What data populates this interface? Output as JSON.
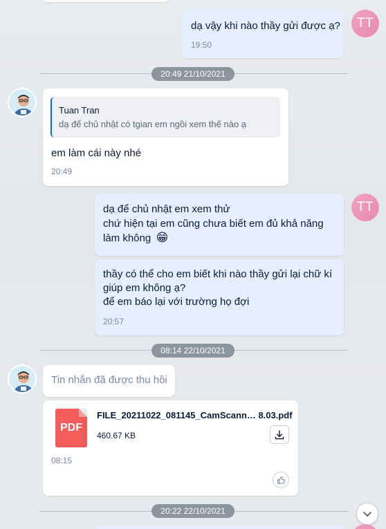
{
  "messages": {
    "m1": {
      "avatar": "TT",
      "text": "dạ vậy khi nào thầy gửi được ạ?",
      "time": "19:50"
    },
    "divider1": "20:49 21/10/2021",
    "m2": {
      "quote_author": "Tuan Tran",
      "quote_text": "dạ để chủ nhật có tgian em ngồi xem thế nào ạ",
      "text": "em làm cái này nhé",
      "time": "20:49"
    },
    "m3": {
      "avatar": "TT",
      "line1": "dạ để chủ nhật em xem thử",
      "line2": "chứ hiện tại em cũng chưa biết em đủ khả năng",
      "line3": "làm không",
      "emoji": "😁"
    },
    "m4": {
      "line1": "thầy có thể cho em biết khi nào thầy gửi lại chữ kí",
      "line2": "giúp em không ạ?",
      "line3": "để em báo lại với trường họ đợi",
      "time": "20:57"
    },
    "divider2": "08:14 22/10/2021",
    "m5": {
      "text": "Tin nhắn đã được thu hồi"
    },
    "m6": {
      "file_icon_label": "PDF",
      "file_name": "FILE_20211022_081145_CamScann… 8.03.pdf",
      "file_size": "460.67 KB",
      "time": "08:15"
    },
    "divider3": "20:22 22/10/2021"
  },
  "icons": {
    "download": "download-icon",
    "like": "thumbs-up-icon",
    "scroll_down": "chevron-down-icon"
  },
  "colors": {
    "my_bubble": "#e5efff",
    "their_bubble": "#ffffff",
    "avatar_tt": "#ee9bbb",
    "pdf": "#f45b5b",
    "accent": "#0068ff"
  }
}
